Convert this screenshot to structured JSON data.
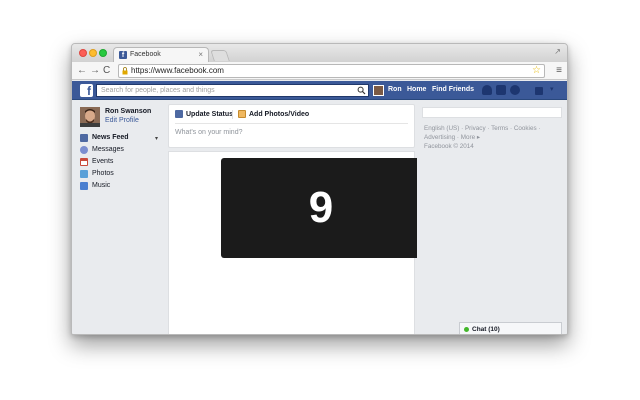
{
  "browser": {
    "tab_title": "Facebook",
    "tab_close": "×",
    "url": "https://www.facebook.com",
    "nav_back": "←",
    "nav_forward": "→",
    "nav_reload": "C",
    "menu": "≡",
    "star": "☆",
    "resize": "↗"
  },
  "fbbar": {
    "logo": "f",
    "search_placeholder": "Search for people, places and things",
    "user_name": "Ron",
    "home": "Home",
    "find_friends": "Find Friends"
  },
  "profile": {
    "name": "Ron Swanson",
    "edit": "Edit Profile"
  },
  "leftnav": {
    "items": [
      {
        "label": "News Feed"
      },
      {
        "label": "Messages"
      },
      {
        "label": "Events"
      },
      {
        "label": "Photos"
      },
      {
        "label": "Music"
      }
    ],
    "caret": "▾"
  },
  "composer": {
    "update_status": "Update Status",
    "add_photos": "Add Photos/Video",
    "placeholder": "What's on your mind?"
  },
  "feed": {
    "countdown": "9"
  },
  "footer": {
    "links": [
      "English (US)",
      "Privacy",
      "Terms",
      "Cookies",
      "Advertising",
      "More"
    ],
    "more_arrow": "▸",
    "copyright": "Facebook © 2014"
  },
  "chat": {
    "label": "Chat (10)"
  },
  "colors": {
    "fb_blue": "#3b5998",
    "page_bg": "#e9ebee"
  }
}
